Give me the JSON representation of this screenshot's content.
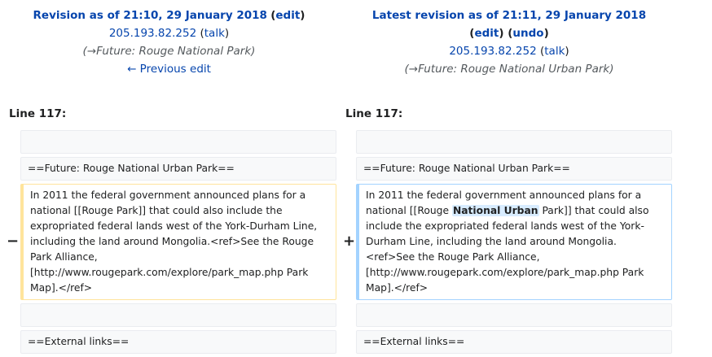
{
  "left_header": {
    "title": "Revision as of 21:10, 29 January 2018",
    "edit": "edit",
    "user": "205.193.82.252",
    "talk": "talk",
    "summary_arrow": "→",
    "summary": "Future: Rouge National Park",
    "prev_edit": "← Previous edit"
  },
  "right_header": {
    "title": "Latest revision as of 21:11, 29 January 2018",
    "edit": "edit",
    "undo": "undo",
    "user": "205.193.82.252",
    "talk": "talk",
    "summary_arrow": "→",
    "summary": "Future: Rouge National Urban Park"
  },
  "line_label": "Line 117:",
  "left_rows": {
    "empty1": "",
    "heading": "==Future: Rouge National Urban Park==",
    "changed": "In 2011 the federal government announced plans for a national [[Rouge Park]] that could also include the expropriated federal lands west of the York-Durham Line, including the land around Mongolia.<ref>See the Rouge Park Alliance, [http://www.rougepark.com/explore/park_map.php Park Map].</ref>",
    "empty2": "",
    "external": "==External links=="
  },
  "right_rows": {
    "empty1": "",
    "heading": "==Future: Rouge National Urban Park==",
    "changed_before": "In 2011 the federal government announced plans for a national [[Rouge ",
    "changed_inserted": "National Urban",
    "changed_after": " Park]] that could also include the expropriated federal lands west of the York-Durham Line, including the land around Mongolia.<ref>See the Rouge Park Alliance, [http://www.rougepark.com/explore/park_map.php Park Map].</ref>",
    "empty2": "",
    "external": "==External links=="
  },
  "markers": {
    "minus": "−",
    "plus": "+"
  }
}
